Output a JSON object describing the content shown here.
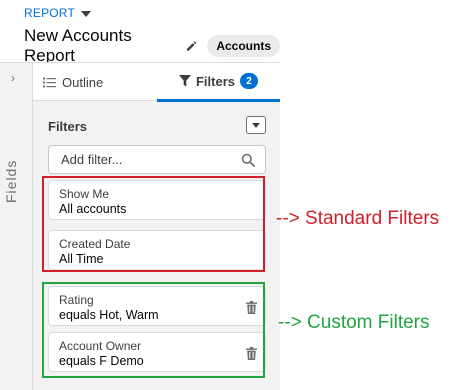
{
  "header": {
    "report_label": "REPORT",
    "title": "New Accounts Report",
    "object_badge": "Accounts"
  },
  "rail": {
    "label": "Fields",
    "chevron": "›"
  },
  "tabs": [
    {
      "label": "Outline",
      "icon": "list-icon"
    },
    {
      "label": "Filters",
      "icon": "funnel-icon",
      "count": "2"
    }
  ],
  "filters_panel": {
    "heading": "Filters",
    "search_placeholder": "Add filter..."
  },
  "standard_filters": [
    {
      "name": "Show Me",
      "value": "All accounts"
    },
    {
      "name": "Created Date",
      "value": "All Time"
    }
  ],
  "custom_filters": [
    {
      "name": "Rating",
      "value": "equals Hot, Warm"
    },
    {
      "name": "Account Owner",
      "value": "equals F Demo"
    }
  ],
  "annotations": {
    "standard": "--> Standard Filters",
    "custom": "--> Custom Filters"
  },
  "colors": {
    "accent": "#0070d2",
    "standard_box": "#d0202a",
    "custom_box": "#22a53f"
  }
}
